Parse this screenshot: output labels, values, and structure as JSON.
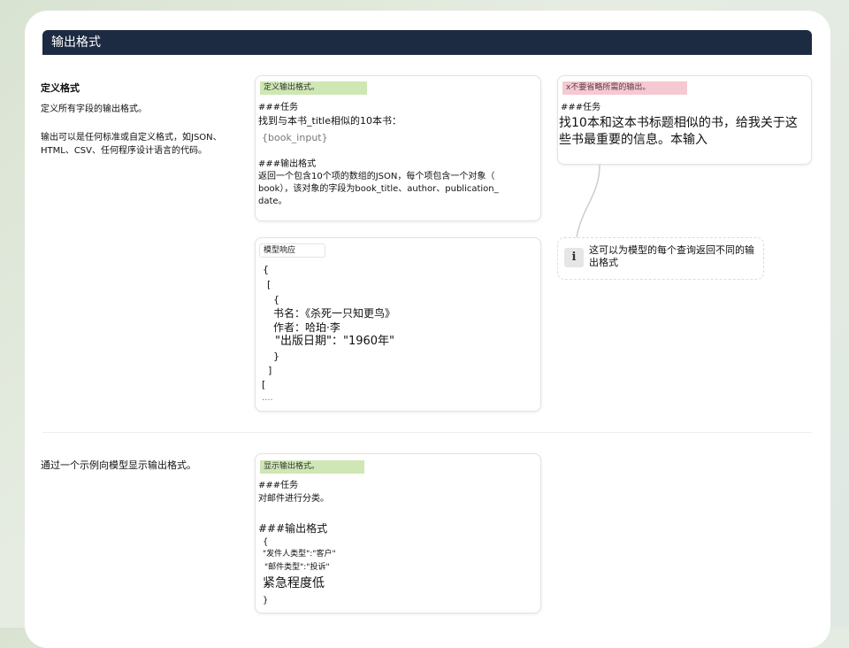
{
  "header": {
    "title": "输出格式"
  },
  "section1": {
    "title": "定义格式",
    "desc": "定义所有字段的输出格式。",
    "note_line1": "输出可以是任何标准或自定义格式，如JSON、",
    "note_line2": "HTML、CSV、任何程序设计语言的代码。"
  },
  "prompt_box": {
    "tag": "定义输出格式。",
    "task_heading": "###任务",
    "task_line": "找到与本书_title相似的10本书：",
    "placeholder": "{book_input}",
    "format_heading": "###输出格式",
    "format_lines": [
      "返回一个包含10个项的数组的JSON，每个项包含一个对象（",
      "book），该对象的字段为book_title、author、publication_",
      "date。"
    ]
  },
  "bad_box": {
    "tag": "x不要省略所需的输出。",
    "task_heading": "###任务",
    "line1": "找10本和这本书标题相似的书，给我关于这",
    "line2": "些书最重要的信息。本输入"
  },
  "response_box": {
    "tag": "模型响应",
    "lines": [
      "{",
      "[",
      "{",
      "书名：《杀死一只知更鸟》",
      "作者：哈珀·李",
      "\"出版日期\"：\"1960年\"",
      "}",
      "]",
      "[",
      "...."
    ]
  },
  "info": {
    "icon": "i",
    "line1": "这可以为模型的每个查询返回不同的输",
    "line2": "出格式"
  },
  "section2": {
    "title": "通过一个示例向模型显示输出格式。"
  },
  "example_box": {
    "tag": "显示输出格式。",
    "task_heading": "###任务",
    "task_line": "对邮件进行分类。",
    "format_heading": "###输出格式",
    "lines": [
      "{",
      "\"发件人类型\":\"客户\"",
      "\"邮件类型\":\"投诉\"",
      "紧急程度低",
      "}"
    ]
  },
  "colors": {
    "header_bg": "#1c2b42",
    "green_tag": "#cfe7b4",
    "pink_tag": "#f4c9d2"
  }
}
